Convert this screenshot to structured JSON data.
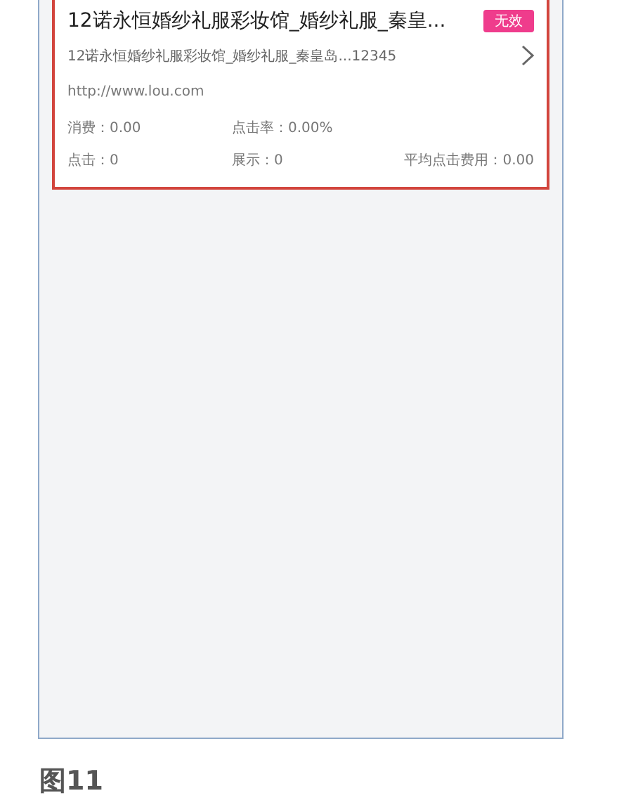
{
  "ad_card": {
    "title": "12诺永恒婚纱礼服彩妆馆_婚纱礼服_秦皇...",
    "badge": "无效",
    "description": "12诺永恒婚纱礼服彩妆馆_婚纱礼服_秦皇岛...12345",
    "url": "http://www.lou.com",
    "stat_rows": [
      [
        "消费：0.00",
        "点击率：0.00%"
      ],
      [
        "点击：0",
        "展示：0",
        "平均点击费用：0.00"
      ]
    ]
  },
  "caption": "图11"
}
